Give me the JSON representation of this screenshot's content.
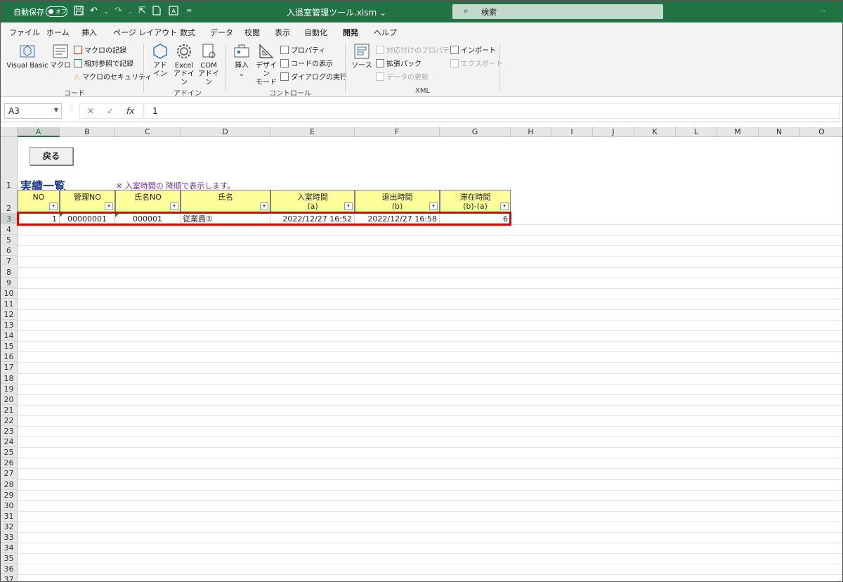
{
  "title_bar": {
    "autosave_label": "自動保存",
    "autosave_state": "オフ",
    "filename": "入退室管理ツール.xlsm ⌄",
    "search_placeholder": "検索"
  },
  "menu_tabs": [
    "ファイル",
    "ホーム",
    "挿入",
    "ページ レイアウト",
    "数式",
    "データ",
    "校閲",
    "表示",
    "自動化",
    "開発",
    "ヘルプ"
  ],
  "active_tab": "開発",
  "ribbon": {
    "groups": [
      {
        "label": "コード"
      },
      {
        "label": "アドイン"
      },
      {
        "label": "コントロール"
      },
      {
        "label": "XML"
      }
    ],
    "code": {
      "visual_basic": "Visual Basic",
      "macro": "マクロ",
      "record_macro": "マクロの記録",
      "relative_ref": "相対参照で記録",
      "macro_security": "マクロのセキュリティ"
    },
    "addins": {
      "addin_line1": "アド",
      "addin_line2": "イン",
      "excel_addin_line1": "Excel",
      "excel_addin_line2": "アドイン",
      "com_addin_line1": "COM",
      "com_addin_line2": "アドイン"
    },
    "controls": {
      "insert_line1": "挿入",
      "insert_line2": "⌄",
      "design_mode_line1": "デザイン",
      "design_mode_line2": "モード",
      "properties": "プロパティ",
      "view_code": "コードの表示",
      "run_dialog": "ダイアログの実行"
    },
    "xml": {
      "source": "ソース",
      "map_properties": "対応付けのプロパティ",
      "expansion_packs": "拡張パック",
      "refresh_data": "データの更新",
      "import": "インポート",
      "export": "エクスポート"
    }
  },
  "formula_bar": {
    "name_box": "A3",
    "formula": "1"
  },
  "columns": [
    "A",
    "B",
    "C",
    "D",
    "E",
    "F",
    "G",
    "H",
    "I",
    "J",
    "K",
    "L",
    "M",
    "N",
    "O"
  ],
  "selected_column": "A",
  "selected_row": "3",
  "sheet": {
    "back_button": "戻る",
    "title": "実績一覧",
    "note": "※ 入室時間の 降順で表示します。",
    "headers": [
      {
        "line1": "NO",
        "line2": ""
      },
      {
        "line1": "管理NO",
        "line2": ""
      },
      {
        "line1": "氏名NO",
        "line2": ""
      },
      {
        "line1": "氏名",
        "line2": ""
      },
      {
        "line1": "入室時間",
        "line2": "(a)"
      },
      {
        "line1": "退出時間",
        "line2": "(b)"
      },
      {
        "line1": "滞在時間",
        "line2": "(b)-(a)"
      }
    ],
    "filter_glyph": "▾",
    "row": [
      "1",
      "00000001",
      "000001",
      "従業員①",
      "2022/12/27 16:52",
      "2022/12/27 16:58",
      "6"
    ]
  }
}
